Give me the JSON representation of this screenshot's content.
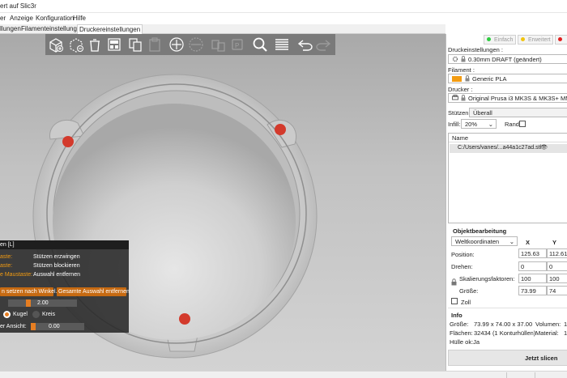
{
  "window": {
    "title": "ert auf Slic3r"
  },
  "menu": [
    "er",
    "Anzeige",
    "Konfiguration",
    "Hilfe"
  ],
  "tabs": [
    {
      "label": "llungen"
    },
    {
      "label": "Filamenteinstellungen"
    },
    {
      "label": "Druckereinstellungen"
    }
  ],
  "toolbar": {
    "icons": [
      "add-object-icon",
      "delete-icon",
      "delete-all-icon",
      "arrange-icon",
      "copy-icon",
      "paste-icon",
      "add-instance-icon",
      "remove-instance-icon",
      "split-objects-icon",
      "split-parts-icon",
      "search-icon",
      "layers-icon",
      "undo-icon",
      "redo-icon"
    ]
  },
  "gizmo": {
    "header": "en [L]",
    "rows": [
      {
        "label": "aste:",
        "value": "Stützen erzwingen"
      },
      {
        "label": "aste:",
        "value": "Stützen blockieren"
      },
      {
        "label": "e Maustaste:",
        "value": "Auswahl entfernen"
      }
    ],
    "btn_angle": "n setzen nach Winkel...",
    "btn_clear": "Gesamte Auswahl entfernen",
    "brush_size": "2.00",
    "shape_sphere": "Kugel",
    "shape_circle": "Kreis",
    "clipping_label": "er Ansicht:",
    "clipping_value": "0.00",
    "brush_fraction": 0.28,
    "clipping_fraction": 0.0
  },
  "modes": [
    {
      "label": "Einfach",
      "color": "#2ecc40"
    },
    {
      "label": "Erweitert",
      "color": "#f1c40f"
    },
    {
      "label": "",
      "color": "#e02020"
    }
  ],
  "print": {
    "settings_label": "Druckeinstellungen :",
    "settings_value": "0.30mm DRAFT (geändert)",
    "filament_label": "Filament :",
    "filament_value": "Generic PLA",
    "filament_color": "#f39c12",
    "printer_label": "Drucker :",
    "printer_value": "Original Prusa i3 MK3S & MK3S+ MMU2S",
    "supports_label": "Stützen:",
    "supports_value": "Überall",
    "infill_label": "Infill:",
    "infill_value": "20%",
    "brim_label": "Rand:"
  },
  "objects": {
    "header": "Name",
    "items": [
      {
        "name": "C:/Users/vanes/...a44a1c27ad.stl"
      }
    ]
  },
  "manipulation": {
    "title": "Objektbearbeitung",
    "coord_select": "Weltkoordinaten",
    "col_x": "X",
    "col_y": "Y",
    "position_label": "Position:",
    "position": [
      "125.63",
      "112.61"
    ],
    "rotation_label": "Drehen:",
    "rotation": [
      "0",
      "0"
    ],
    "scale_label": "Skalierungsfaktoren:",
    "scale": [
      "100",
      "100"
    ],
    "size_label": "Größe:",
    "size": [
      "73.99",
      "74"
    ],
    "inch_label": "Zoll"
  },
  "info": {
    "title": "Info",
    "size_label": "Größe:",
    "size_value": "73.99 x 74.00 x 37.00",
    "volume_label": "Volumen:",
    "volume_value": "1",
    "facets_label": "Flächen:",
    "facets_value": "32434 (1 Konturhüllen)",
    "material_label": "Material:",
    "material_value": "1",
    "hull_label": "Hülle ok:Ja"
  },
  "slice_button": "Jetzt slicen"
}
